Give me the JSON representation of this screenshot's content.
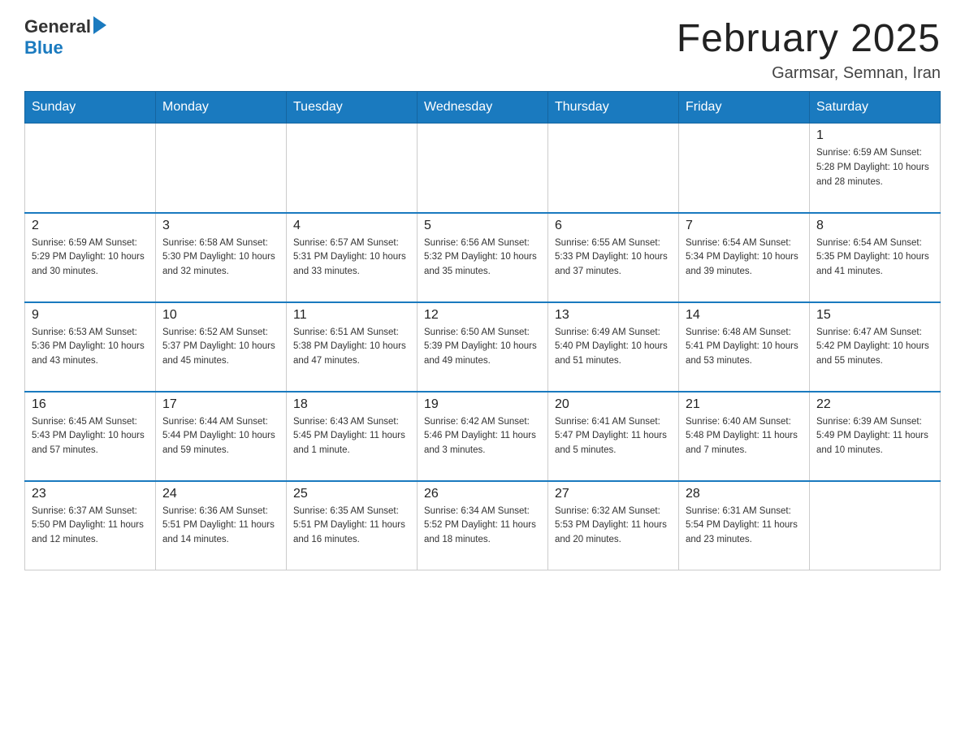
{
  "header": {
    "month_title": "February 2025",
    "location": "Garmsar, Semnan, Iran",
    "logo_general": "General",
    "logo_blue": "Blue"
  },
  "days_of_week": [
    "Sunday",
    "Monday",
    "Tuesday",
    "Wednesday",
    "Thursday",
    "Friday",
    "Saturday"
  ],
  "weeks": [
    {
      "days": [
        {
          "date": "",
          "info": ""
        },
        {
          "date": "",
          "info": ""
        },
        {
          "date": "",
          "info": ""
        },
        {
          "date": "",
          "info": ""
        },
        {
          "date": "",
          "info": ""
        },
        {
          "date": "",
          "info": ""
        },
        {
          "date": "1",
          "info": "Sunrise: 6:59 AM\nSunset: 5:28 PM\nDaylight: 10 hours\nand 28 minutes."
        }
      ]
    },
    {
      "days": [
        {
          "date": "2",
          "info": "Sunrise: 6:59 AM\nSunset: 5:29 PM\nDaylight: 10 hours\nand 30 minutes."
        },
        {
          "date": "3",
          "info": "Sunrise: 6:58 AM\nSunset: 5:30 PM\nDaylight: 10 hours\nand 32 minutes."
        },
        {
          "date": "4",
          "info": "Sunrise: 6:57 AM\nSunset: 5:31 PM\nDaylight: 10 hours\nand 33 minutes."
        },
        {
          "date": "5",
          "info": "Sunrise: 6:56 AM\nSunset: 5:32 PM\nDaylight: 10 hours\nand 35 minutes."
        },
        {
          "date": "6",
          "info": "Sunrise: 6:55 AM\nSunset: 5:33 PM\nDaylight: 10 hours\nand 37 minutes."
        },
        {
          "date": "7",
          "info": "Sunrise: 6:54 AM\nSunset: 5:34 PM\nDaylight: 10 hours\nand 39 minutes."
        },
        {
          "date": "8",
          "info": "Sunrise: 6:54 AM\nSunset: 5:35 PM\nDaylight: 10 hours\nand 41 minutes."
        }
      ]
    },
    {
      "days": [
        {
          "date": "9",
          "info": "Sunrise: 6:53 AM\nSunset: 5:36 PM\nDaylight: 10 hours\nand 43 minutes."
        },
        {
          "date": "10",
          "info": "Sunrise: 6:52 AM\nSunset: 5:37 PM\nDaylight: 10 hours\nand 45 minutes."
        },
        {
          "date": "11",
          "info": "Sunrise: 6:51 AM\nSunset: 5:38 PM\nDaylight: 10 hours\nand 47 minutes."
        },
        {
          "date": "12",
          "info": "Sunrise: 6:50 AM\nSunset: 5:39 PM\nDaylight: 10 hours\nand 49 minutes."
        },
        {
          "date": "13",
          "info": "Sunrise: 6:49 AM\nSunset: 5:40 PM\nDaylight: 10 hours\nand 51 minutes."
        },
        {
          "date": "14",
          "info": "Sunrise: 6:48 AM\nSunset: 5:41 PM\nDaylight: 10 hours\nand 53 minutes."
        },
        {
          "date": "15",
          "info": "Sunrise: 6:47 AM\nSunset: 5:42 PM\nDaylight: 10 hours\nand 55 minutes."
        }
      ]
    },
    {
      "days": [
        {
          "date": "16",
          "info": "Sunrise: 6:45 AM\nSunset: 5:43 PM\nDaylight: 10 hours\nand 57 minutes."
        },
        {
          "date": "17",
          "info": "Sunrise: 6:44 AM\nSunset: 5:44 PM\nDaylight: 10 hours\nand 59 minutes."
        },
        {
          "date": "18",
          "info": "Sunrise: 6:43 AM\nSunset: 5:45 PM\nDaylight: 11 hours\nand 1 minute."
        },
        {
          "date": "19",
          "info": "Sunrise: 6:42 AM\nSunset: 5:46 PM\nDaylight: 11 hours\nand 3 minutes."
        },
        {
          "date": "20",
          "info": "Sunrise: 6:41 AM\nSunset: 5:47 PM\nDaylight: 11 hours\nand 5 minutes."
        },
        {
          "date": "21",
          "info": "Sunrise: 6:40 AM\nSunset: 5:48 PM\nDaylight: 11 hours\nand 7 minutes."
        },
        {
          "date": "22",
          "info": "Sunrise: 6:39 AM\nSunset: 5:49 PM\nDaylight: 11 hours\nand 10 minutes."
        }
      ]
    },
    {
      "days": [
        {
          "date": "23",
          "info": "Sunrise: 6:37 AM\nSunset: 5:50 PM\nDaylight: 11 hours\nand 12 minutes."
        },
        {
          "date": "24",
          "info": "Sunrise: 6:36 AM\nSunset: 5:51 PM\nDaylight: 11 hours\nand 14 minutes."
        },
        {
          "date": "25",
          "info": "Sunrise: 6:35 AM\nSunset: 5:51 PM\nDaylight: 11 hours\nand 16 minutes."
        },
        {
          "date": "26",
          "info": "Sunrise: 6:34 AM\nSunset: 5:52 PM\nDaylight: 11 hours\nand 18 minutes."
        },
        {
          "date": "27",
          "info": "Sunrise: 6:32 AM\nSunset: 5:53 PM\nDaylight: 11 hours\nand 20 minutes."
        },
        {
          "date": "28",
          "info": "Sunrise: 6:31 AM\nSunset: 5:54 PM\nDaylight: 11 hours\nand 23 minutes."
        },
        {
          "date": "",
          "info": ""
        }
      ]
    }
  ]
}
